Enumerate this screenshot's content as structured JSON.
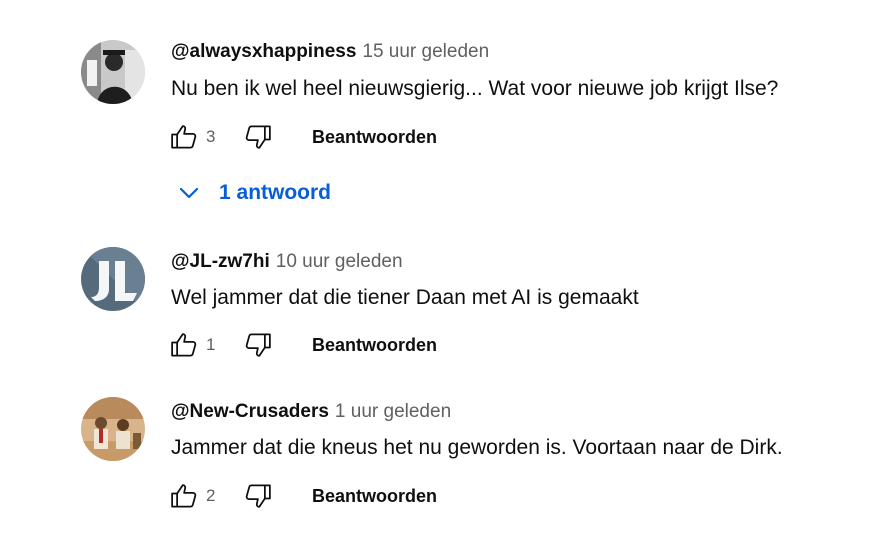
{
  "comments": [
    {
      "author": "@alwaysxhappiness",
      "time": "15 uur geleden",
      "text": "Nu ben ik wel heel nieuwsgierig... Wat voor nieuwe job krijgt Ilse?",
      "likes": "3",
      "reply_label": "Beantwoorden",
      "replies_toggle": "1 antwoord"
    },
    {
      "author": "@JL-zw7hi",
      "time": "10 uur geleden",
      "text": "Wel jammer dat die tiener Daan met AI is gemaakt",
      "likes": "1",
      "reply_label": "Beantwoorden"
    },
    {
      "author": "@New-Crusaders",
      "time": "1 uur geleden",
      "text": "Jammer dat die kneus het nu geworden is. Voortaan naar de Dirk.",
      "likes": "2",
      "reply_label": "Beantwoorden"
    }
  ],
  "colors": {
    "text": "#0f0f0f",
    "secondary": "#606060",
    "link": "#065fd4"
  },
  "icons": [
    "thumb-up-icon",
    "thumb-down-icon",
    "chevron-down-icon"
  ]
}
